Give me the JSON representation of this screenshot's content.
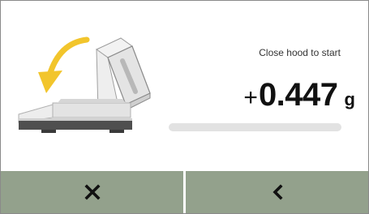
{
  "status": {
    "message": "Close hood to start"
  },
  "reading": {
    "sign": "+",
    "value": "0.447",
    "unit": "g"
  },
  "progress": {
    "fraction": 0
  },
  "buttons": {
    "cancel_icon": "close-icon",
    "back_icon": "chevron-left-icon"
  },
  "colors": {
    "button_bg": "#93a18c",
    "arrow": "#f2c52c",
    "progress_track": "#e2e2e2"
  }
}
